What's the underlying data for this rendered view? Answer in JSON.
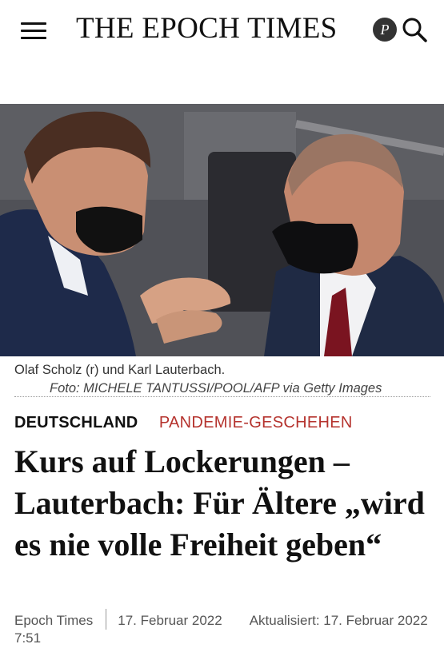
{
  "header": {
    "logo_text": "THE EPOCH TIMES",
    "premium_letter": "P",
    "menu_icon": "hamburger-menu-icon",
    "search_icon": "search-icon"
  },
  "image": {
    "caption": "Olaf Scholz (r) und Karl Lauterbach.",
    "credit": "Foto: MICHELE TANTUSSI/POOL/AFP via Getty Images"
  },
  "article": {
    "category": "DEUTSCHLAND",
    "subcategory": "PANDEMIE-GESCHEHEN",
    "headline": "Kurs auf Lockerungen – Lauterbach: Für Ältere „wird es nie volle Freiheit geben“",
    "author": "Epoch Times",
    "date": "17. Februar 2022",
    "updated": "Aktualisiert: 17. Februar 2022 7:51"
  },
  "colors": {
    "accent_red": "#b5332e",
    "text": "#111111"
  }
}
